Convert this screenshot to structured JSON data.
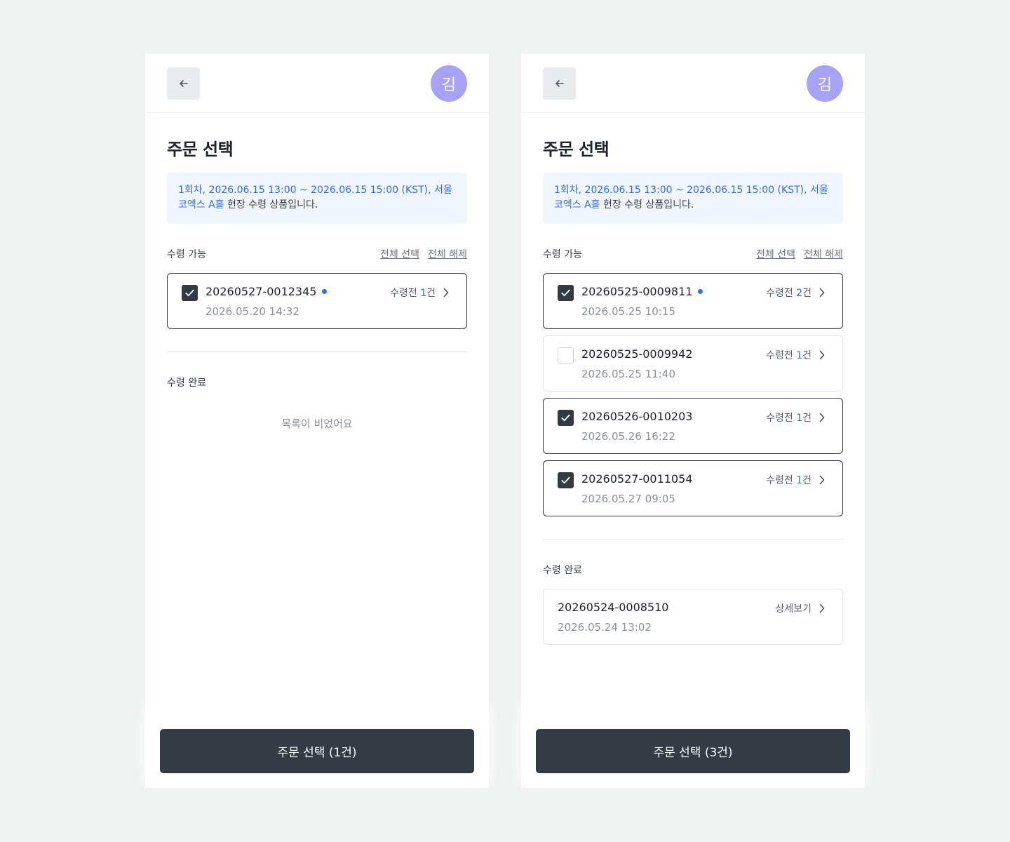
{
  "colors": {
    "accent": "#2f6fe0",
    "avatar_bg": "#a8a2f6",
    "primary_button": "#353b45"
  },
  "screens": [
    {
      "avatar_initial": "김",
      "title": "주문 선택",
      "info": {
        "highlight_1": "1회차, 2026.06.15 13:00 ~ 2026.06.15 15:00 (KST), 서울 코엑스 A홀",
        "rest": " 현장 수령 상품입니다."
      },
      "available": {
        "label": "수령 가능",
        "select_all": "전체 선택",
        "deselect_all": "전체 해제",
        "orders": [
          {
            "order_no": "20260527-0012345",
            "date": "2026.05.20 14:32",
            "status_prefix": "수령전 ",
            "count": "1",
            "status_suffix": "건",
            "checked": true,
            "dot": true
          }
        ]
      },
      "completed": {
        "label": "수령 완료",
        "empty_text": "목록이 비었어요"
      },
      "submit_label": "주문 선택 (1건)"
    },
    {
      "avatar_initial": "김",
      "title": "주문 선택",
      "info": {
        "highlight_1": "1회차, 2026.06.15 13:00 ~ 2026.06.15 15:00 (KST), 서울 코엑스 A홀",
        "rest": " 현장 수령 상품입니다."
      },
      "available": {
        "label": "수령 가능",
        "select_all": "전체 선택",
        "deselect_all": "전체 해제",
        "orders": [
          {
            "order_no": "20260525-0009811",
            "date": "2026.05.25 10:15",
            "status_prefix": "수령전 ",
            "count": "2",
            "status_suffix": "건",
            "checked": true,
            "dot": true
          },
          {
            "order_no": "20260525-0009942",
            "date": "2026.05.25 11:40",
            "status_prefix": "수령전 ",
            "count": "1",
            "status_suffix": "건",
            "checked": false,
            "dot": false
          },
          {
            "order_no": "20260526-0010203",
            "date": "2026.05.26 16:22",
            "status_prefix": "수령전 ",
            "count": "1",
            "status_suffix": "건",
            "checked": true,
            "dot": false
          },
          {
            "order_no": "20260527-0011054",
            "date": "2026.05.27 09:05",
            "status_prefix": "수령전 ",
            "count": "1",
            "status_suffix": "건",
            "checked": true,
            "dot": false
          }
        ]
      },
      "completed": {
        "label": "수령 완료",
        "orders": [
          {
            "order_no": "20260524-0008510",
            "date": "2026.05.24 13:02",
            "action": "상세보기"
          }
        ]
      },
      "submit_label": "주문 선택 (3건)"
    }
  ],
  "icons": {
    "back": "arrow-left-icon",
    "chevron": "chevron-right-icon",
    "check": "check-icon"
  }
}
